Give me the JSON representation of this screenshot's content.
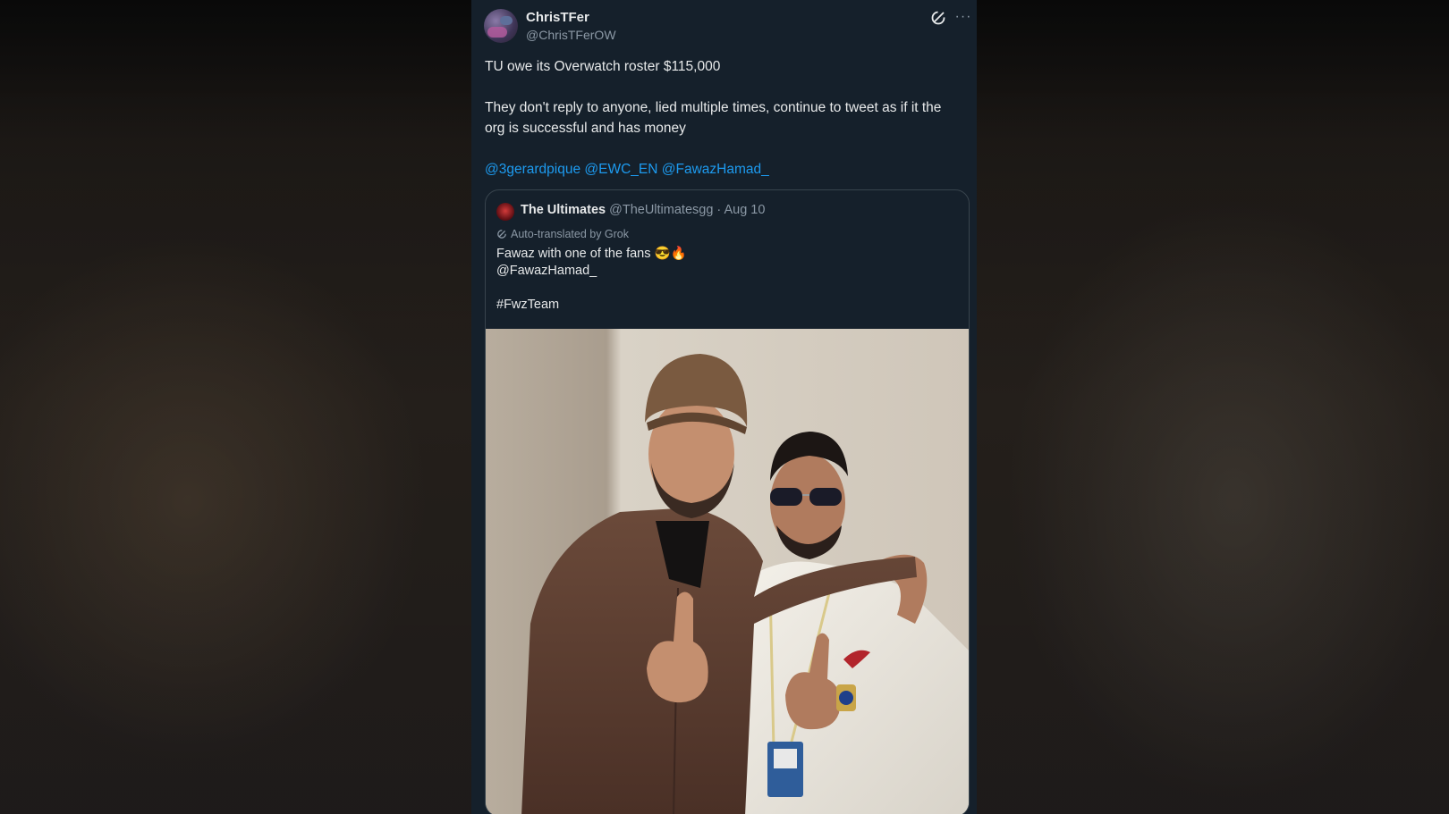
{
  "tweet": {
    "display_name": "ChrisTFer",
    "handle": "@ChrisTFerOW",
    "lines": [
      "TU owe its Overwatch roster $115,000",
      "They don't reply to anyone, lied multiple times, continue to tweet as if it the org is successful and has money"
    ],
    "mentions": [
      "@3gerardpique",
      "@EWC_EN",
      "@FawazHamad_"
    ],
    "icons": [
      "grok-icon",
      "more-icon"
    ]
  },
  "quote": {
    "display_name": "The Ultimates",
    "handle": "@TheUltimatesgg",
    "date": "· Aug 10",
    "translated_label": "Auto-translated by Grok",
    "text_line": "Fawaz with one of the fans 😎🔥",
    "mention": "@FawazHamad_",
    "hashtag": "#FwzTeam"
  },
  "colors": {
    "card_bg": "#15202b",
    "link": "#1d9bf0",
    "text": "#e7e9ea",
    "muted": "#8b98a5",
    "border": "#38444d"
  }
}
